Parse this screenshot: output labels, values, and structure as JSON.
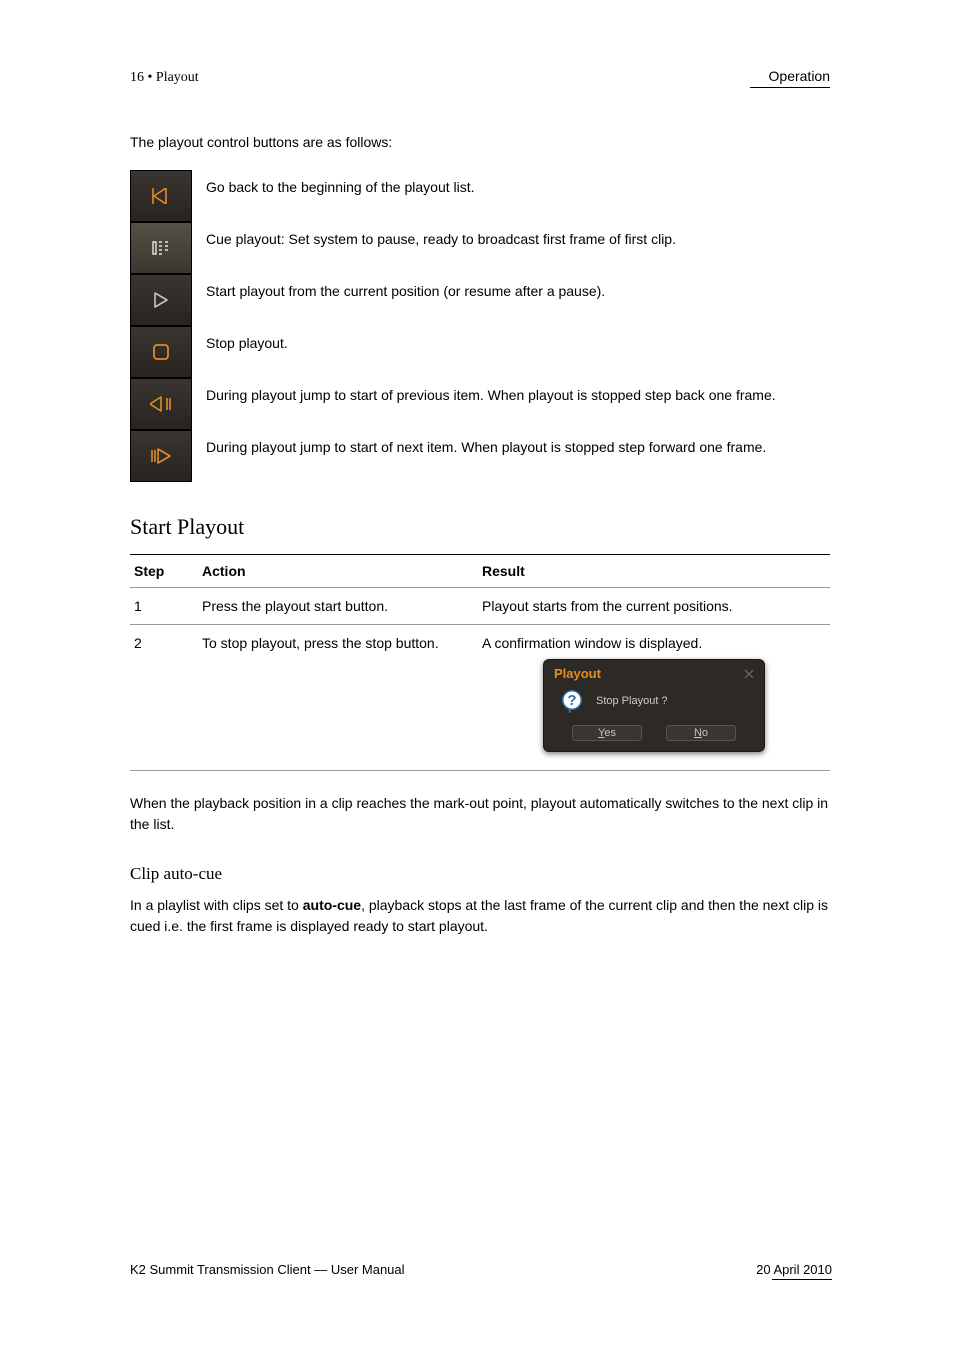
{
  "header": {
    "left": "16 • Playout",
    "right": "Operation"
  },
  "intro": "The playout control buttons are as follows:",
  "icons": [
    {
      "name": "skip-back-icon",
      "desc": "Go back to the beginning of the playout list.",
      "orange": true,
      "selected": false
    },
    {
      "name": "cue-icon",
      "desc": "Cue playout: Set system to pause, ready to broadcast first frame of first clip.",
      "orange": false,
      "selected": true
    },
    {
      "name": "play-icon",
      "desc": "Start playout from the current position (or resume after a pause).",
      "orange": false,
      "selected": false
    },
    {
      "name": "stop-icon",
      "desc": "Stop playout.",
      "orange": true,
      "selected": false
    },
    {
      "name": "frame-back-icon",
      "desc": "During playout jump to start of previous item.\nWhen playout is stopped step back one frame.",
      "orange": true,
      "selected": false
    },
    {
      "name": "frame-forward-icon",
      "desc": "During playout jump to start of next item.\nWhen playout is stopped step forward one frame.",
      "orange": true,
      "selected": false
    }
  ],
  "steps_heading": "Start Playout",
  "table": {
    "headers": {
      "step": "Step",
      "action": "Action",
      "result": "Result"
    },
    "rows": [
      {
        "step": "1",
        "action": "Press the playout start button.",
        "result": "Playout starts from the current positions."
      },
      {
        "step": "2",
        "action": "To stop playout, press the stop button.",
        "result": "A confirmation window is displayed.",
        "has_dialog": true
      }
    ]
  },
  "dialog": {
    "title": "Playout",
    "message": "Stop Playout ?",
    "yes": "Yes",
    "no": "No"
  },
  "paras": {
    "p1": "When the playback position in a clip reaches the mark-out point, playout automatically switches to the next clip in the list.",
    "sub": "Clip auto-cue",
    "p2a": "In a playlist with clips set to ",
    "p2b": "auto-cue",
    "p2c": ", playback stops at the last frame of the current clip and then the next clip is cued i.e. the first frame is displayed ready to start playout."
  },
  "footer": {
    "left": "K2 Summit Transmission Client — User Manual",
    "right": "20 April 2010"
  }
}
